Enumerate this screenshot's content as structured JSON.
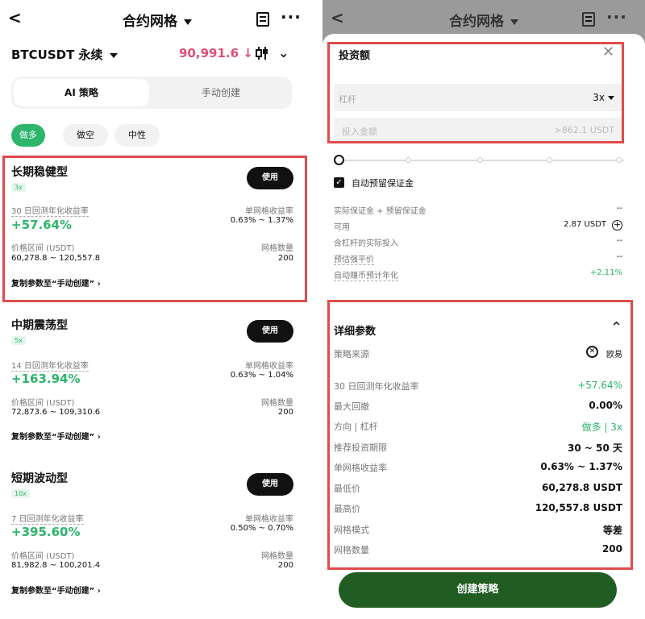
{
  "left": {
    "header": {
      "title": "合约网格"
    },
    "pair": "BTCUSDT 永续",
    "price": "90,991.6 ↓",
    "tabs": {
      "ai": "AI 策略",
      "manual": "手动创建"
    },
    "filters": [
      "做多",
      "做空",
      "中性"
    ],
    "cards": [
      {
        "title": "长期稳健型",
        "leverage": "3x",
        "use": "使用",
        "apr_label": "30 日回测年化收益率",
        "apr": "+57.64%",
        "grid_profit_label": "单网格收益率",
        "grid_profit": "0.63% ~ 1.37%",
        "range_label": "价格区间 (USDT)",
        "range": "60,278.8 ~ 120,557.8",
        "grid_count_label": "网格数量",
        "grid_count": "200",
        "copy": "复制参数至“手动创建”"
      },
      {
        "title": "中期震荡型",
        "leverage": "5x",
        "use": "使用",
        "apr_label": "14 日回测年化收益率",
        "apr": "+163.94%",
        "grid_profit_label": "单网格收益率",
        "grid_profit": "0.63% ~ 1.04%",
        "range_label": "价格区间 (USDT)",
        "range": "72,873.6 ~ 109,310.6",
        "grid_count_label": "网格数量",
        "grid_count": "200",
        "copy": "复制参数至“手动创建”"
      },
      {
        "title": "短期波动型",
        "leverage": "10x",
        "use": "使用",
        "apr_label": "7 日回测年化收益率",
        "apr": "+395.60%",
        "grid_profit_label": "单网格收益率",
        "grid_profit": "0.50% ~ 0.70%",
        "range_label": "价格区间 (USDT)",
        "range": "81,982.8 ~ 100,201.4",
        "grid_count_label": "网格数量",
        "grid_count": "200",
        "copy": "复制参数至“手动创建”"
      }
    ]
  },
  "right": {
    "header": {
      "title": "合约网格"
    },
    "invest_title": "投资额",
    "leverage_label": "杠杆",
    "leverage_value": "3x",
    "amount_placeholder": "投入金额",
    "amount_hint": ">862.1 USDT",
    "auto_margin": "自动预留保证金",
    "info": [
      {
        "label": "实际保证金 + 预留保证金",
        "value": "--"
      },
      {
        "label": "可用",
        "value": "2.87 USDT"
      },
      {
        "label": "含杠杆的实际投入",
        "value": "--"
      },
      {
        "label": "预估强平价",
        "value": "--"
      },
      {
        "label": "自动赚币预计年化",
        "value": "+2.11%"
      }
    ],
    "details_title": "详细参数",
    "source_label": "策略来源",
    "source_value": "欧易",
    "details": [
      {
        "label": "30 日回测年化收益率",
        "value": "+57.64%"
      },
      {
        "label": "最大回撤",
        "value": "0.00%"
      },
      {
        "label": "方向 | 杠杆",
        "value": "做多 | 3x"
      },
      {
        "label": "推荐投资期限",
        "value": "30 ~ 50 天"
      },
      {
        "label": "单网格收益率",
        "value": "0.63% ~ 1.37%"
      },
      {
        "label": "最低价",
        "value": "60,278.8 USDT"
      },
      {
        "label": "最高价",
        "value": "120,557.8 USDT"
      },
      {
        "label": "网格模式",
        "value": "等差"
      },
      {
        "label": "网格数量",
        "value": "200"
      }
    ],
    "create_button": "创建策略"
  },
  "colors": {
    "green": "#2cb56b",
    "price_pink": "#e0507a",
    "highlight_red": "#e04b4b",
    "create_btn": "#215c22"
  }
}
